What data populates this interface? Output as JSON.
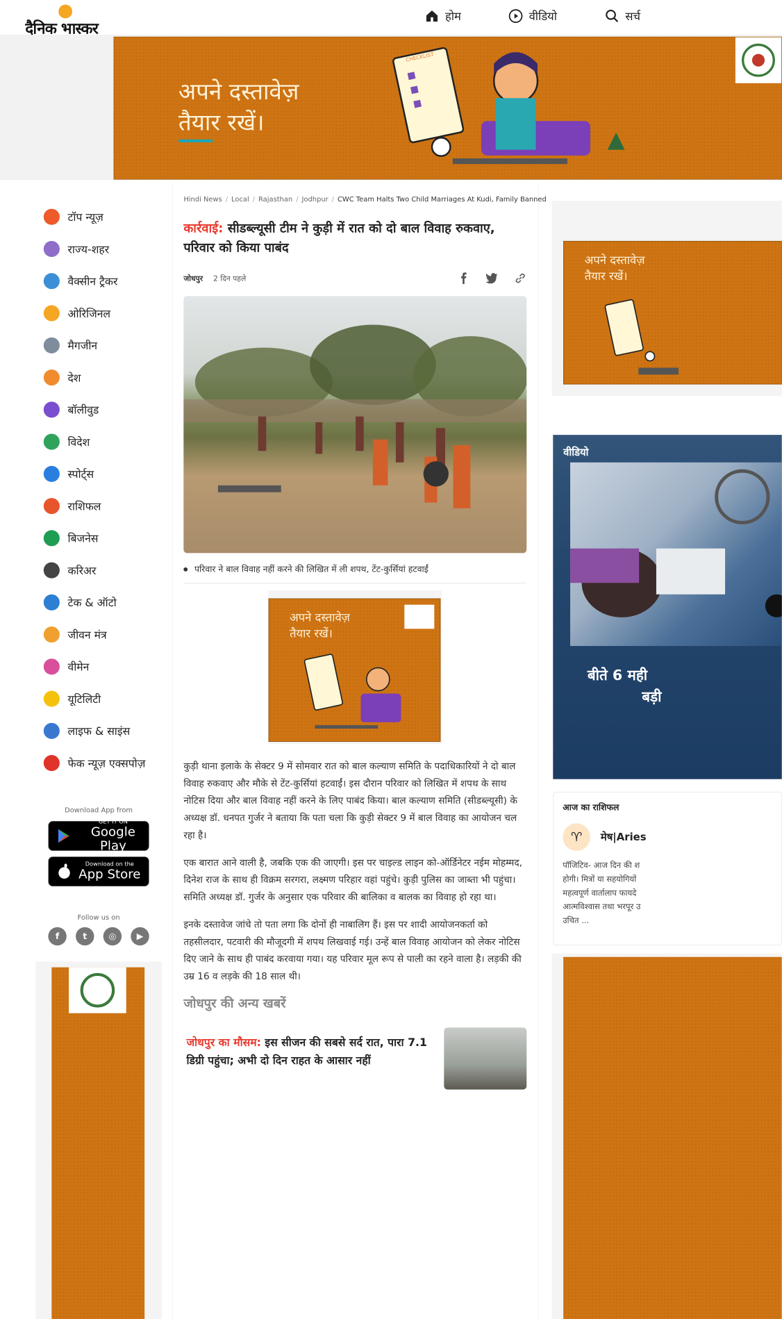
{
  "header": {
    "logo_text": "दैनिक भास्कर",
    "nav": [
      {
        "label": "होम",
        "icon": "home-icon"
      },
      {
        "label": "वीडियो",
        "icon": "play-circle-icon"
      },
      {
        "label": "सर्च",
        "icon": "search-icon"
      }
    ]
  },
  "top_banner": {
    "line1": "अपने दस्तावेज़",
    "line2": "तैयार रखें।",
    "badge": "CHECKLIST"
  },
  "sidebar": {
    "items": [
      {
        "label": "टॉप न्यूज़",
        "icon": "flame-icon",
        "color": "#ef5a2a"
      },
      {
        "label": "राज्य-शहर",
        "icon": "city-icon",
        "color": "#8e6ec8"
      },
      {
        "label": "वैक्सीन ट्रैकर",
        "icon": "syringe-icon",
        "color": "#3b8fd6"
      },
      {
        "label": "ओरिजिनल",
        "icon": "original-icon",
        "color": "#f5a623"
      },
      {
        "label": "मैगजीन",
        "icon": "magazine-icon",
        "color": "#7f8c9b"
      },
      {
        "label": "देश",
        "icon": "india-gate-icon",
        "color": "#f08c2e"
      },
      {
        "label": "बॉलीवुड",
        "icon": "clapperboard-icon",
        "color": "#7a4fcf"
      },
      {
        "label": "विदेश",
        "icon": "globe-icon",
        "color": "#2fa35b"
      },
      {
        "label": "स्पोर्ट्स",
        "icon": "runner-icon",
        "color": "#2a7ee0"
      },
      {
        "label": "राशिफल",
        "icon": "zodiac-icon",
        "color": "#e8552d"
      },
      {
        "label": "बिजनेस",
        "icon": "rupee-icon",
        "color": "#1f9d55"
      },
      {
        "label": "करिअर",
        "icon": "graduation-cap-icon",
        "color": "#444"
      },
      {
        "label": "टेक & ऑटो",
        "icon": "tech-auto-icon",
        "color": "#2d7fd3"
      },
      {
        "label": "जीवन मंत्र",
        "icon": "book-icon",
        "color": "#f0a030"
      },
      {
        "label": "वीमेन",
        "icon": "women-icon",
        "color": "#d94f9b"
      },
      {
        "label": "यूटिलिटी",
        "icon": "bulb-icon",
        "color": "#f4c20d"
      },
      {
        "label": "लाइफ & साइंस",
        "icon": "dna-icon",
        "color": "#3a78d0"
      },
      {
        "label": "फेक न्यूज़ एक्सपोज़",
        "icon": "fake-icon",
        "color": "#e0332c"
      }
    ],
    "download_label": "Download App from",
    "google_play": {
      "small": "GET IT ON",
      "big": "Google Play"
    },
    "app_store": {
      "small": "Download on the",
      "big": "App Store"
    },
    "follow_label": "Follow us on",
    "social": [
      {
        "icon": "facebook-icon",
        "glyph": "f"
      },
      {
        "icon": "twitter-icon",
        "glyph": "t"
      },
      {
        "icon": "instagram-icon",
        "glyph": "◎"
      },
      {
        "icon": "youtube-icon",
        "glyph": "▶"
      }
    ]
  },
  "breadcrumb": [
    "Hindi News",
    "Local",
    "Rajasthan",
    "Jodhpur",
    "CWC Team Halts Two Child Marriages At Kudi, Family Banned"
  ],
  "article": {
    "kicker": "कार्रवाई:",
    "title": " सीडब्ल्यूसी टीम ने कुड़ी में रात को दो बाल विवाह रुकवाए, परिवार को किया पाबंद",
    "city": "जोधपुर",
    "time": "2 दिन पहले",
    "caption": "परिवार ने बाल विवाह नहीं करने की लिखित में ली शपथ, टेंट-कुर्सियां हटवाईं",
    "ad_text1": "अपने दस्तावेज़",
    "ad_text2": "तैयार रखें।",
    "paragraphs": [
      "कुड़ी थाना इलाके के सेक्टर 9 में सोमवार रात को बाल कल्याण समिति के पदाधिकारियों ने दो बाल विवाह रुकवाए और मौके से टेंट-कुर्सियां हटवाईं। इस दौरान परिवार को लिखित में शपथ के साथ नोटिस दिया और बाल विवाह नहीं करने के लिए पाबंद किया। बाल कल्याण समिति (सीडब्ल्यूसी) के अध्यक्ष डॉ. धनपत गुर्जर ने बताया कि पता चला कि कुड़ी सेक्टर 9 में बाल विवाह का आयोजन चल रहा है।",
      "एक बारात आने वाली है, जबकि एक की जाएगी। इस पर चाइल्ड लाइन को-ऑर्डिनेटर नईम मोहम्मद, दिनेश राज के साथ ही विक्रम सरगरा, लक्ष्मण परिहार वहां पहुंचे। कुड़ी पुलिस का जाब्ता भी पहुंचा। समिति अध्यक्ष डॉ. गुर्जर के अनुसार एक परिवार की बालिका व बालक का विवाह हो रहा था।",
      "इनके दस्तावेज जांचे तो पता लगा कि दोनों ही नाबालिग हैं। इस पर शादी आयोजनकर्ता को तहसीलदार, पटवारी की मौजूदगी में शपथ लिखवाई गई। उन्हें बाल विवाह आयोजन को लेकर नोटिस दिए जाने के साथ ही पाबंद करवाया गया। यह परिवार मूल रूप से पाली का रहने वाला है। लड़की की उम्र 16 व लड़के की 18 साल थी।"
    ],
    "more_title": "जोधपुर की अन्य खबरें",
    "related": {
      "kicker": "जोधपुर का मौसम:",
      "title": " इस सीजन की सबसे सर्द रात, पारा 7.1 डिग्री पहुंचा; अभी दो दिन राहत के आसार नहीं"
    }
  },
  "right": {
    "ad_text1": "अपने दस्तावेज़",
    "ad_text2": "तैयार रखें।",
    "video_label": "वीडियो",
    "video_caption_1": "बीते 6 मही",
    "video_caption_2": "बड़ी",
    "rashi_title": "आज का राशिफल",
    "rashi_name": "मेष|Aries",
    "rashi_desc": [
      "पॉजिटिव- आज दिन की श",
      "होगी। मित्रों या सहयोगियों",
      "महत्वपूर्ण वार्तालाप फायदे",
      "आत्मविश्वास तथा भरपूर उ",
      "उचित ..."
    ]
  },
  "colors": {
    "accent": "#e8382d",
    "ad_orange": "#cf7413"
  }
}
